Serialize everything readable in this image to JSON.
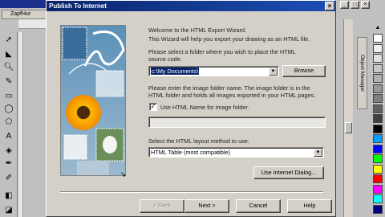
{
  "app": {
    "title_fragment": "",
    "doc_tab": "ZapfHur",
    "object_manager_tab": "Object Manager"
  },
  "dialog": {
    "title": "Publish To Internet",
    "close_glyph": "×",
    "welcome": "Welcome to the HTML Export Wizard.",
    "intro": "This Wizard will help you export your drawing as an HTML file.",
    "folder_prompt_1": "Please select a folder where you wish to place the HTML",
    "folder_prompt_2": "source code.",
    "folder_value": "c:\\My Documents\\",
    "browse_label": "Browse",
    "image_prompt_1": "Please enter the image folder name. The image folder is in the",
    "image_prompt_2": "HTML folder and holds all images exported in your HTML pages.",
    "use_html_name_label": "Use HTML Name for image folder.",
    "use_html_name_checked": true,
    "image_folder_value": "",
    "layout_prompt": "Select the HTML layout method to use:",
    "layout_value": "HTML Table (most compatible)",
    "use_internet_dialog_label": "Use Internet Dialog...",
    "back_label": "< Back",
    "next_label": "Next >",
    "cancel_label": "Cancel",
    "help_label": "Help"
  },
  "colors": {
    "title_bar": "#0a246a",
    "dialog_bg": "#d4d0c8",
    "palette": [
      "#ffffff",
      "#f0f0f0",
      "#e0e0e0",
      "#c8c8c8",
      "#b0b0b0",
      "#989898",
      "#808080",
      "#606060",
      "#404040",
      "#000000",
      "#00a0ff",
      "#0000ff",
      "#00ff00",
      "#ffff00",
      "#ff0000",
      "#ff00ff",
      "#00ffff",
      "#000080"
    ]
  }
}
